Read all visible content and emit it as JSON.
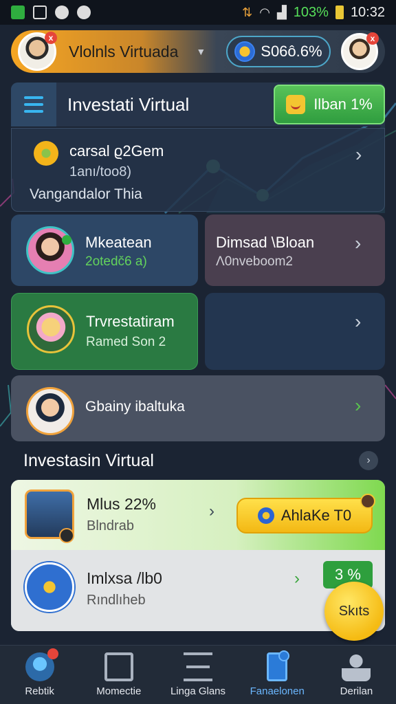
{
  "status_bar": {
    "battery": "103%",
    "time": "10:32"
  },
  "header": {
    "title": "Vlolnls Virtuada",
    "coin_value": "S06ô.6%",
    "avatar_badge": "x",
    "avatar_right_badge": "x"
  },
  "title_row": {
    "title": "Investati Virtual",
    "promo_label": "Ilban 1%"
  },
  "cards": {
    "card1": {
      "title": "carsal ϱ2Gem",
      "subtitle": "1anı/too8)",
      "footer": "Vangandalor Thia"
    },
    "card2": {
      "title": "Mkeatean",
      "subtitle": "2otedč6 a)"
    },
    "card3": {
      "title": "Dimsad \\Bloan",
      "subtitle": "Λ0nveboom2"
    },
    "card4": {
      "title": "Trvrestatiram",
      "subtitle": "Ramed Son 2"
    },
    "card5": {
      "title": "Gbainy ibaltuka"
    }
  },
  "section": {
    "title": "Investasin Virtual"
  },
  "list": {
    "items": [
      {
        "title": "Mlus 22%",
        "subtitle": "Blndrab",
        "action": "AhlaKe T0"
      },
      {
        "title": "Imlxsa /lb0",
        "subtitle": "Rındlıheb",
        "badge": "3 %"
      }
    ],
    "start_label": "Skıts"
  },
  "bottom_nav": {
    "items": [
      {
        "label": "Rebtik",
        "icon": "home-icon"
      },
      {
        "label": "Momectie",
        "icon": "box-icon"
      },
      {
        "label": "Linga Glans",
        "icon": "lines-icon"
      },
      {
        "label": "Fanaelonen",
        "icon": "phone-icon"
      },
      {
        "label": "Derilan",
        "icon": "user-icon"
      }
    ]
  },
  "colors": {
    "background": "#1b2433",
    "accent_blue": "#38b6f0",
    "accent_green": "#2e9f3d",
    "accent_yellow": "#f5bb13",
    "active_nav": "#6bb7ff"
  }
}
